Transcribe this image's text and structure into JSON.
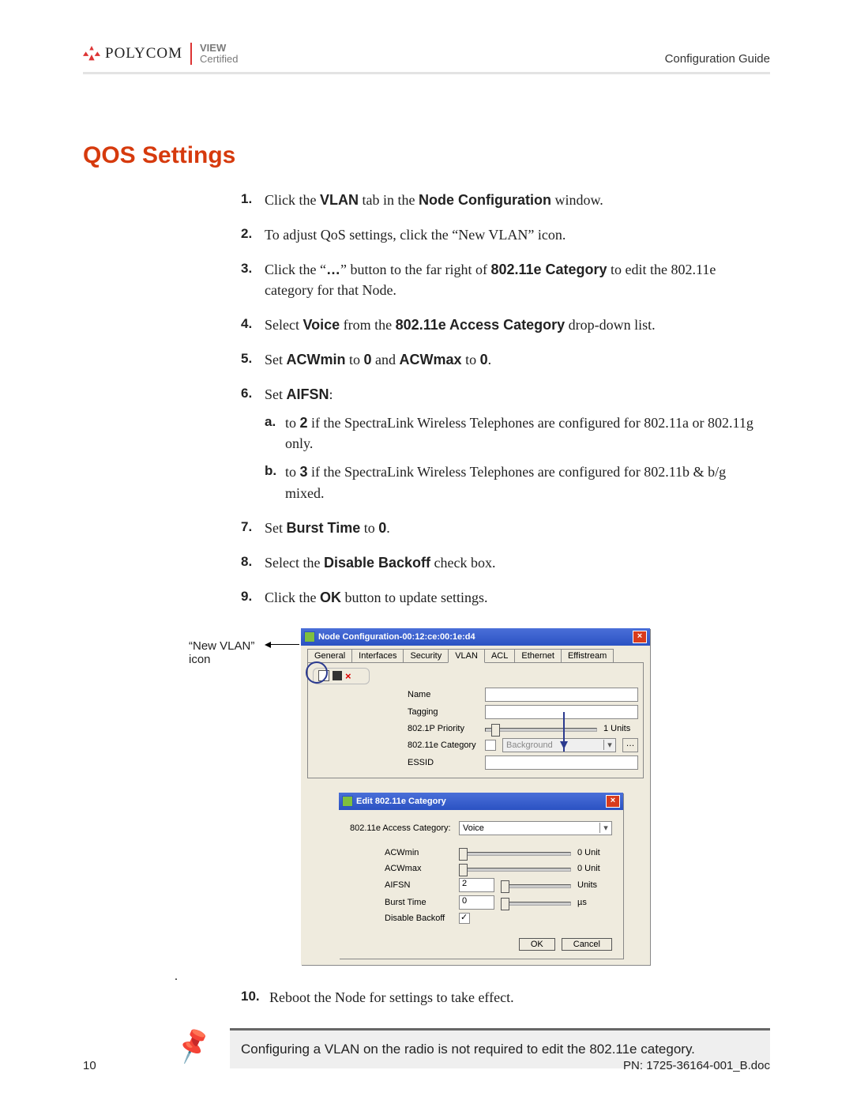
{
  "header": {
    "brand": "POLYCOM",
    "cert_line1": "VIEW",
    "cert_line2": "Certified",
    "right": "Configuration Guide"
  },
  "section_title": "QOS Settings",
  "steps": {
    "s1": {
      "num": "1.",
      "t1": "Click the ",
      "b1": "VLAN",
      "t2": " tab in the ",
      "b2": "Node Configuration",
      "t3": " window."
    },
    "s2": {
      "num": "2.",
      "t1": "To adjust QoS settings, click the “New VLAN” icon."
    },
    "s3": {
      "num": "3.",
      "t1": "Click the “",
      "b1": "…",
      "t2": "” button to the far right of ",
      "b2": "802.11e Category",
      "t3": " to edit the 802.11e category for that Node."
    },
    "s4": {
      "num": "4.",
      "t1": "Select ",
      "b1": "Voice",
      "t2": " from the ",
      "b2": "802.11e Access Category",
      "t3": " drop-down list."
    },
    "s5": {
      "num": "5.",
      "t1": "Set ",
      "b1": "ACWmin",
      "t2": " to ",
      "b2": "0",
      "t3": " and ",
      "b3": "ACWmax",
      "t4": " to ",
      "b4": "0",
      "t5": "."
    },
    "s6": {
      "num": "6.",
      "t1": "Set ",
      "b1": "AIFSN",
      "t2": ":"
    },
    "s6a": {
      "num": "a.",
      "t1": "to ",
      "b1": "2",
      "t2": " if the SpectraLink Wireless Telephones are configured for 802.11a or 802.11g only."
    },
    "s6b": {
      "num": "b.",
      "t1": "to ",
      "b1": "3",
      "t2": " if the SpectraLink Wireless Telephones are configured for 802.11b & b/g mixed."
    },
    "s7": {
      "num": "7.",
      "t1": "Set ",
      "b1": "Burst Time",
      "t2": " to ",
      "b2": "0",
      "t3": "."
    },
    "s8": {
      "num": "8.",
      "t1": "Select the ",
      "b1": "Disable Backoff",
      "t2": " check box."
    },
    "s9": {
      "num": "9.",
      "t1": "Click the ",
      "b1": "OK",
      "t2": " button to update settings."
    },
    "s10": {
      "num": "10.",
      "t1": "Reboot the Node for settings to take effect."
    }
  },
  "callout": {
    "line1": "“New VLAN”",
    "line2": "icon"
  },
  "outer_window": {
    "title": "Node Configuration-00:12:ce:00:1e:d4",
    "tabs": [
      "General",
      "Interfaces",
      "Security",
      "VLAN",
      "ACL",
      "Ethernet",
      "Effistream"
    ],
    "active_tab_index": 3,
    "rows": {
      "name": "Name",
      "tagging": "Tagging",
      "priority": "802.1P Priority",
      "priority_units": "1 Units",
      "category": "802.11e Category",
      "category_value": "Background",
      "essid": "ESSID"
    },
    "more_btn": "…"
  },
  "inner_window": {
    "title": "Edit 802.11e Category",
    "access_label": "802.11e Access Category:",
    "access_value": "Voice",
    "rows": {
      "acwmin": {
        "label": "ACWmin",
        "unit": "0 Unit"
      },
      "acwmax": {
        "label": "ACWmax",
        "unit": "0 Unit"
      },
      "aifsn": {
        "label": "AIFSN",
        "value": "2",
        "unit": "Units"
      },
      "burst": {
        "label": "Burst Time",
        "value": "0",
        "unit": "µs"
      },
      "backoff": {
        "label": "Disable Backoff"
      }
    },
    "ok": "OK",
    "cancel": "Cancel"
  },
  "trailing_dot": ".",
  "note": "Configuring a VLAN on the radio is not required to edit the 802.11e category.",
  "footer": {
    "page": "10",
    "pn": "PN: 1725-36164-001_B.doc"
  }
}
